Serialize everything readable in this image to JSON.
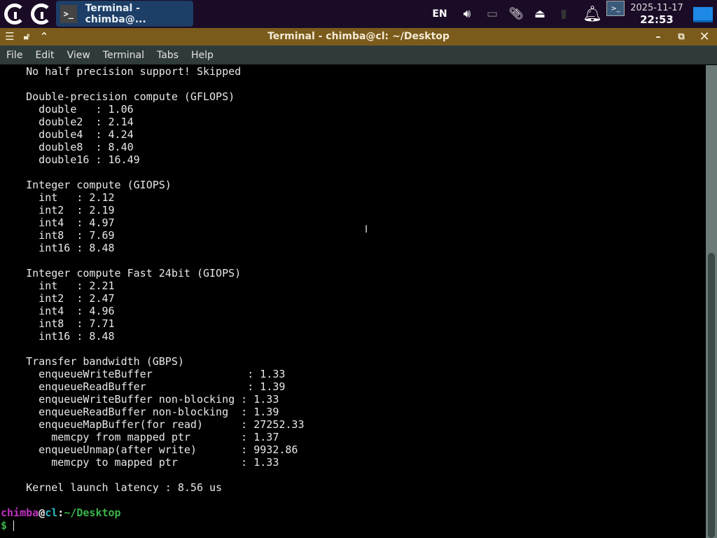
{
  "panel": {
    "task_label": "Terminal - chimba@...",
    "lang": "EN",
    "date": "2025-11-17",
    "time": "22:53"
  },
  "window": {
    "title": "Terminal - chimba@cl: ~/Desktop"
  },
  "menu": [
    "File",
    "Edit",
    "View",
    "Terminal",
    "Tabs",
    "Help"
  ],
  "terminal": {
    "lines": [
      "    No half precision support! Skipped",
      "",
      "    Double-precision compute (GFLOPS)",
      "      double   : 1.06",
      "      double2  : 2.14",
      "      double4  : 4.24",
      "      double8  : 8.40",
      "      double16 : 16.49",
      "",
      "    Integer compute (GIOPS)",
      "      int   : 2.12",
      "      int2  : 2.19",
      "      int4  : 4.97",
      "      int8  : 7.69",
      "      int16 : 8.48",
      "",
      "    Integer compute Fast 24bit (GIOPS)",
      "      int   : 2.21",
      "      int2  : 2.47",
      "      int4  : 4.96",
      "      int8  : 7.71",
      "      int16 : 8.48",
      "",
      "    Transfer bandwidth (GBPS)",
      "      enqueueWriteBuffer               : 1.33",
      "      enqueueReadBuffer                : 1.39",
      "      enqueueWriteBuffer non-blocking : 1.33",
      "      enqueueReadBuffer non-blocking  : 1.39",
      "      enqueueMapBuffer(for read)      : 27252.33",
      "        memcpy from mapped ptr        : 1.37",
      "      enqueueUnmap(after write)       : 9932.86",
      "        memcpy to mapped ptr          : 1.33",
      "",
      "    Kernel launch latency : 8.56 us",
      ""
    ],
    "prompt": {
      "user": "chimba",
      "at": "@",
      "host": "cl",
      "colon": ":",
      "path": "~/Desktop",
      "symbol": "$"
    }
  }
}
